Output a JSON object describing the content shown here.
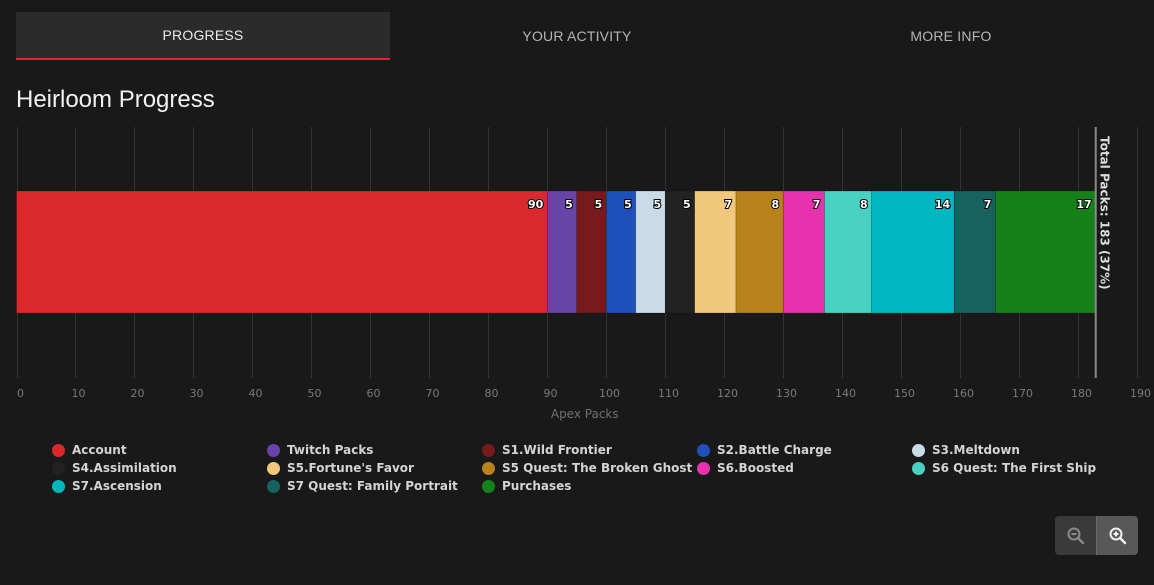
{
  "tabs": [
    {
      "label": "PROGRESS",
      "active": true
    },
    {
      "label": "YOUR ACTIVITY",
      "active": false
    },
    {
      "label": "MORE INFO",
      "active": false
    }
  ],
  "page_title": "Heirloom Progress",
  "zoom_controls": {
    "zoom_out": "zoom-out-icon",
    "zoom_in": "zoom-in-icon"
  },
  "chart_data": {
    "type": "bar",
    "orientation": "horizontal-stacked",
    "title": "Heirloom Progress",
    "xlabel": "Apex Packs",
    "ylabel": "",
    "xlim": [
      0,
      190
    ],
    "xticks": [
      0,
      10,
      20,
      30,
      40,
      50,
      60,
      70,
      80,
      90,
      100,
      110,
      120,
      130,
      140,
      150,
      160,
      170,
      180,
      190
    ],
    "grid": true,
    "legend_position": "bottom",
    "series": [
      {
        "name": "Account",
        "value": 90,
        "color": "#d9292d"
      },
      {
        "name": "Twitch Packs",
        "value": 5,
        "color": "#6844a8"
      },
      {
        "name": "S1.Wild Frontier",
        "value": 5,
        "color": "#761a1c"
      },
      {
        "name": "S2.Battle Charge",
        "value": 5,
        "color": "#1e4fba"
      },
      {
        "name": "S3.Meltdown",
        "value": 5,
        "color": "#c8dbe6"
      },
      {
        "name": "S4.Assimilation",
        "value": 5,
        "color": "#222222"
      },
      {
        "name": "S5.Fortune's Favor",
        "value": 7,
        "color": "#f1c87c"
      },
      {
        "name": "S5 Quest: The Broken Ghost",
        "value": 8,
        "color": "#b8821c"
      },
      {
        "name": "S6.Boosted",
        "value": 7,
        "color": "#e632ae"
      },
      {
        "name": "S6 Quest: The First Ship",
        "value": 8,
        "color": "#48d1c0"
      },
      {
        "name": "S7.Ascension",
        "value": 14,
        "color": "#00b7c0"
      },
      {
        "name": "S7 Quest: Family Portrait",
        "value": 7,
        "color": "#17615f"
      },
      {
        "name": "Purchases",
        "value": 17,
        "color": "#16801b"
      }
    ],
    "plot_line": {
      "value": 183,
      "label": "Total Packs: 183 (37%)"
    }
  }
}
